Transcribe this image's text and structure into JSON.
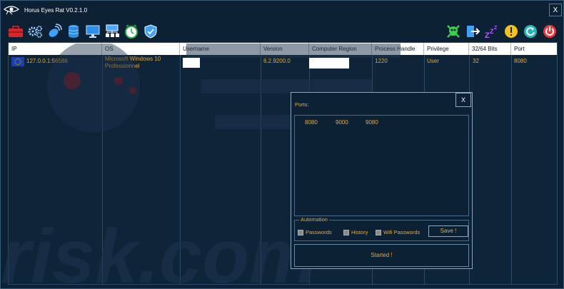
{
  "window": {
    "title": "Horus Eyes Rat V0.2.1.0",
    "close_label": "X"
  },
  "toolbar": {
    "left_icons": [
      "toolbox-icon",
      "settings-icon",
      "satellite-icon",
      "database-icon",
      "monitor-icon",
      "network-icon",
      "clock-icon",
      "shield-icon"
    ],
    "right_icons": [
      "skull-icon",
      "logout-icon",
      "sleep-icon",
      "warning-icon",
      "refresh-icon",
      "power-icon"
    ]
  },
  "table": {
    "columns": [
      "IP",
      "OS",
      "Username",
      "Version",
      "Computer Region",
      "Process Handle",
      "Privilege",
      "32/64 Bits",
      "Port"
    ],
    "rows": [
      {
        "ip": "127.0.0.1:56586",
        "os_line1": "Microsoft Windows 10",
        "os_line2": "Professionnel",
        "username": "",
        "version": "6.2.9200.0",
        "region": "",
        "process_handle": "1220",
        "privilege": "User",
        "bits": "32",
        "port": "8080"
      }
    ]
  },
  "ports_dialog": {
    "close_label": "X",
    "label": "Ports:",
    "ports": [
      "8080",
      "9000",
      "9080"
    ],
    "automation": {
      "legend": "Automation",
      "options": [
        {
          "label": "Passwords",
          "checked": false
        },
        {
          "label": "History",
          "checked": false
        },
        {
          "label": "Wifi Passwords",
          "checked": false
        }
      ],
      "save_label": "Save !"
    },
    "start_label": "Started !"
  },
  "watermark": {
    "text": "risk.com"
  },
  "colors": {
    "accent": "#e8a93a",
    "background": "#0d2135",
    "border": "#3a5a7a"
  }
}
